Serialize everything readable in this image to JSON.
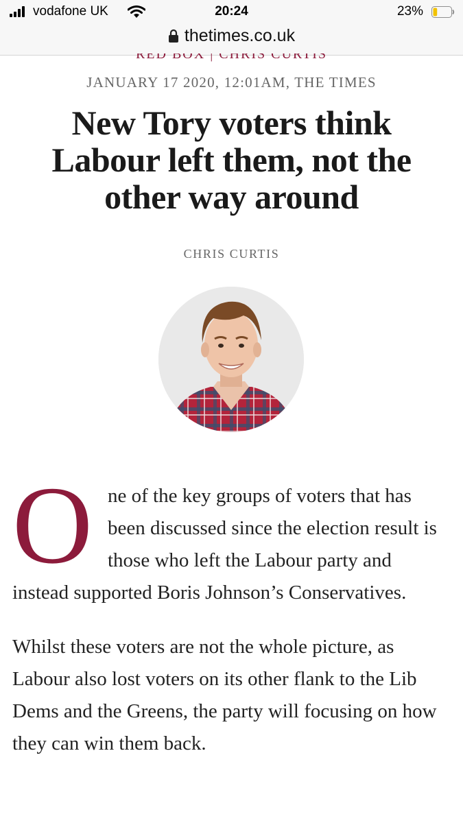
{
  "status_bar": {
    "carrier": "vodafone UK",
    "time": "20:24",
    "battery_percent": "23%",
    "battery_level": 0.23,
    "battery_color": "#f2c200"
  },
  "browser": {
    "domain": "thetimes.co.uk"
  },
  "article": {
    "section": "RED BOX | CHRIS CURTIS",
    "dateline": "JANUARY 17 2020, 12:01AM, THE TIMES",
    "headline": "New Tory voters think Labour left them, not the other way around",
    "author": "CHRIS CURTIS",
    "drop_cap": "O",
    "paragraph1_rest": "ne of the key groups of voters that has been discussed since the election result is those who left the Labour party and instead supported Boris Johnson’s Conservatives.",
    "paragraph2": "Whilst these voters are not the whole picture, as Labour also lost voters on its other flank to the Lib Dems and the Greens, the party will focusing on how they can win them back."
  },
  "colors": {
    "accent": "#8c1b3b",
    "meta_text": "#666666",
    "body_text": "#222222"
  }
}
